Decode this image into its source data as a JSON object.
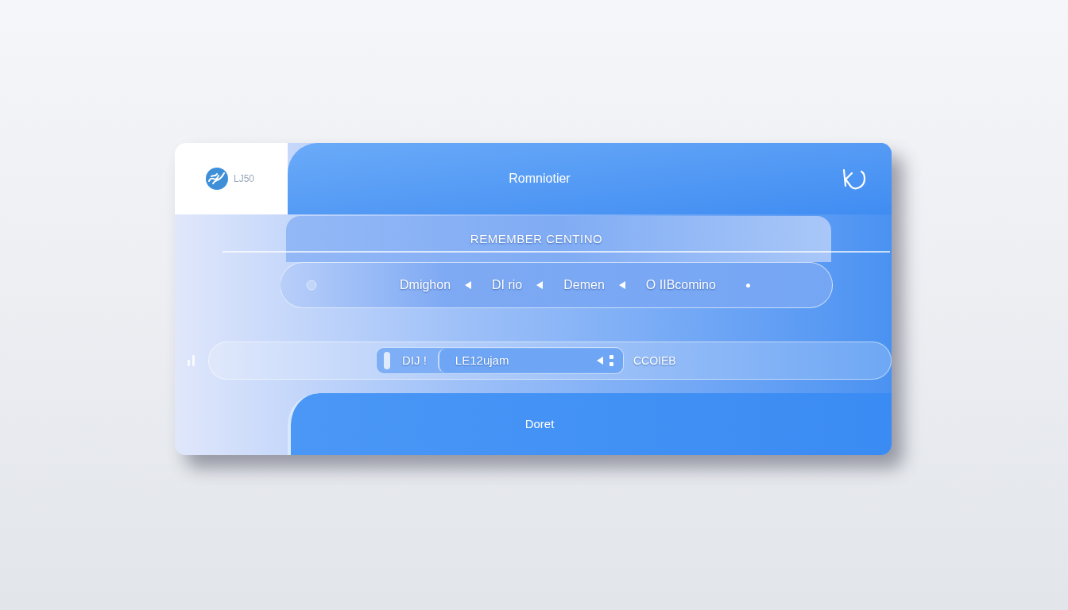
{
  "sidebar": {
    "logo_text": "LJ50"
  },
  "header": {
    "title": "Romniotier"
  },
  "panel": {
    "title": "REMEMBER CENTINO"
  },
  "filter_row": {
    "items": [
      {
        "label": "Dmighon",
        "kind": "select"
      },
      {
        "label": "DI rio",
        "kind": "select"
      },
      {
        "label": "Demen",
        "kind": "select"
      },
      {
        "label": "O IIBcomino",
        "kind": "value"
      }
    ]
  },
  "input_row": {
    "label": "DIJ !",
    "value": "LE12ujam",
    "suffix": "CCOIEB"
  },
  "button": {
    "label": "Doret"
  }
}
